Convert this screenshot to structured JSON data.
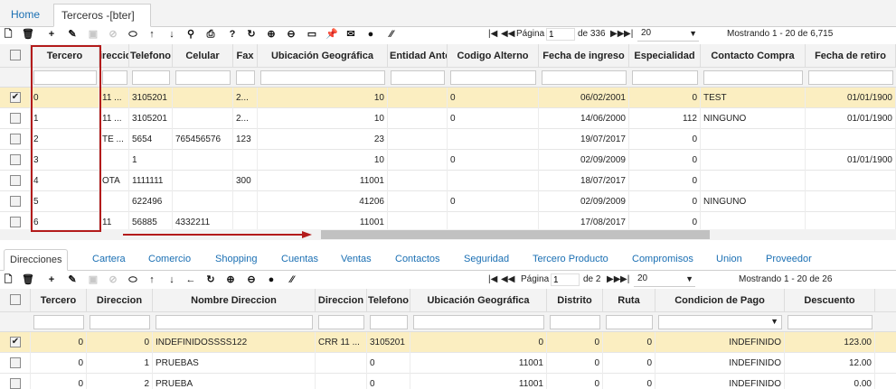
{
  "top_tabs": [
    {
      "label": "Home"
    },
    {
      "label": "Terceros -[bter]"
    }
  ],
  "top_tab_close": "×",
  "main_toolbar": {
    "icons": [
      "new-icon",
      "delete-icon",
      "add-icon",
      "edit-icon",
      "save-icon",
      "cancel-icon",
      "clear-icon",
      "up-arrow-icon",
      "down-arrow-icon",
      "left-arrow-icon",
      "search-icon",
      "print-icon",
      "help-icon",
      "refresh-icon",
      "zoom-in-icon",
      "zoom-out-icon",
      "comment-icon",
      "pin-icon",
      "mail-icon",
      "info-icon",
      "resize-icon"
    ],
    "pager": {
      "first": "|◀",
      "prev": "◀◀",
      "page_label": "Página",
      "page_value": "1",
      "of_label": "de 336",
      "next": "▶▶",
      "last": "▶|",
      "rows_per_page": "20",
      "showing": "Mostrando 1 - 20 de 6,715"
    }
  },
  "main_grid": {
    "columns": [
      "Tercero",
      "ireccion",
      "Telefono",
      "Celular",
      "Fax",
      "Ubicación Geográfica",
      "Entidad Ante",
      "Codigo Alterno",
      "Fecha de ingreso",
      "Especialidad",
      "Contacto Compra",
      "Fecha de retiro"
    ],
    "rows": [
      {
        "checked": "✔",
        "cells": [
          "0",
          "11 ...",
          "3105201",
          "",
          "2...",
          "10",
          "",
          "0",
          "06/02/2001",
          "0",
          "TEST",
          "01/01/1900"
        ]
      },
      {
        "checked": "",
        "cells": [
          "1",
          "11 ...",
          "3105201",
          "",
          "2...",
          "10",
          "",
          "0",
          "14/06/2000",
          "112",
          "NINGUNO",
          "01/01/1900"
        ]
      },
      {
        "checked": "",
        "cells": [
          "2",
          "TE ...",
          "5654",
          "765456576",
          "123",
          "23",
          "",
          "",
          "19/07/2017",
          "0",
          "",
          ""
        ]
      },
      {
        "checked": "",
        "cells": [
          "3",
          "",
          "1",
          "",
          "",
          "10",
          "",
          "0",
          "02/09/2009",
          "0",
          "",
          "01/01/1900"
        ]
      },
      {
        "checked": "",
        "cells": [
          "4",
          "OTA",
          "1111111",
          "",
          "300",
          "11001",
          "",
          "",
          "18/07/2017",
          "0",
          "",
          ""
        ]
      },
      {
        "checked": "",
        "cells": [
          "5",
          "",
          "622496",
          "",
          "",
          "41206",
          "",
          "0",
          "02/09/2009",
          "0",
          "NINGUNO",
          ""
        ]
      },
      {
        "checked": "",
        "cells": [
          "6",
          "11",
          "56885",
          "4332211",
          "",
          "11001",
          "",
          "",
          "17/08/2017",
          "0",
          "",
          ""
        ]
      }
    ]
  },
  "detail_tabs": [
    {
      "label": "Direcciones"
    },
    {
      "label": "Cartera"
    },
    {
      "label": "Comercio"
    },
    {
      "label": "Shopping"
    },
    {
      "label": "Cuentas"
    },
    {
      "label": "Ventas"
    },
    {
      "label": "Contactos"
    },
    {
      "label": "Seguridad"
    },
    {
      "label": "Tercero Producto"
    },
    {
      "label": "Compromisos"
    },
    {
      "label": "Union"
    },
    {
      "label": "Proveedor"
    }
  ],
  "detail_toolbar": {
    "pager": {
      "first": "|◀",
      "prev": "◀◀",
      "page_label": "Página",
      "page_value": "1",
      "of_label": "de 2",
      "next": "▶▶",
      "last": "▶|",
      "rows_per_page": "20",
      "showing": "Mostrando 1 - 20 de 26"
    }
  },
  "detail_grid": {
    "columns": [
      "Tercero",
      "Direccion",
      "Nombre Direccion",
      "Direccion",
      "Telefono",
      "Ubicación Geográfica",
      "Distrito",
      "Ruta",
      "Condicion de Pago",
      "Descuento"
    ],
    "filter_dropdown_arrow": "▼",
    "rows": [
      {
        "checked": "✔",
        "cells": [
          "0",
          "0",
          "INDEFINIDOSSSS122",
          "CRR 11 ...",
          "3105201",
          "0",
          "0",
          "0",
          "INDEFINIDO",
          "123.00"
        ]
      },
      {
        "checked": "",
        "cells": [
          "0",
          "1",
          "PRUEBAS",
          "",
          "0",
          "11001",
          "0",
          "0",
          "INDEFINIDO",
          "12.00"
        ]
      },
      {
        "checked": "",
        "cells": [
          "0",
          "2",
          "PRUEBA",
          "",
          "0",
          "11001",
          "0",
          "0",
          "INDEFINIDO",
          "0.00"
        ]
      }
    ]
  },
  "colors": {
    "selected_row": "#fbeec1",
    "link": "#1a6fb3",
    "highlight_box": "#b31b1b"
  }
}
